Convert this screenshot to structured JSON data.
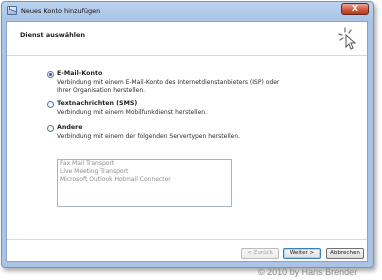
{
  "window": {
    "title": "Neues Konto hinzufügen",
    "close_label": "X"
  },
  "header": {
    "title": "Dienst auswählen"
  },
  "options": [
    {
      "label": "E-Mail-Konto",
      "description": "Verbindung mit einem E-Mail-Konto des Internetdienstanbieters (ISP) oder Ihrer Organisation herstellen.",
      "checked": true
    },
    {
      "label": "Textnachrichten (SMS)",
      "description": "Verbindung mit einem Mobilfunkdienst herstellen.",
      "checked": false
    },
    {
      "label": "Andere",
      "description": "Verbindung mit einem der folgenden Servertypen herstellen.",
      "checked": false
    }
  ],
  "server_types": [
    "Fax Mail Transport",
    "Live Meeting Transport",
    "Microsoft Outlook Hotmail Connector"
  ],
  "buttons": {
    "back": "< Zurück",
    "next": "Weiter >",
    "cancel": "Abbrechen"
  },
  "watermark": "© 2010 by Hans Brender",
  "colors": {
    "selected_radio": "#2a5fa8",
    "close_button": "#d05a3e",
    "frame": "#a9c4e6"
  }
}
